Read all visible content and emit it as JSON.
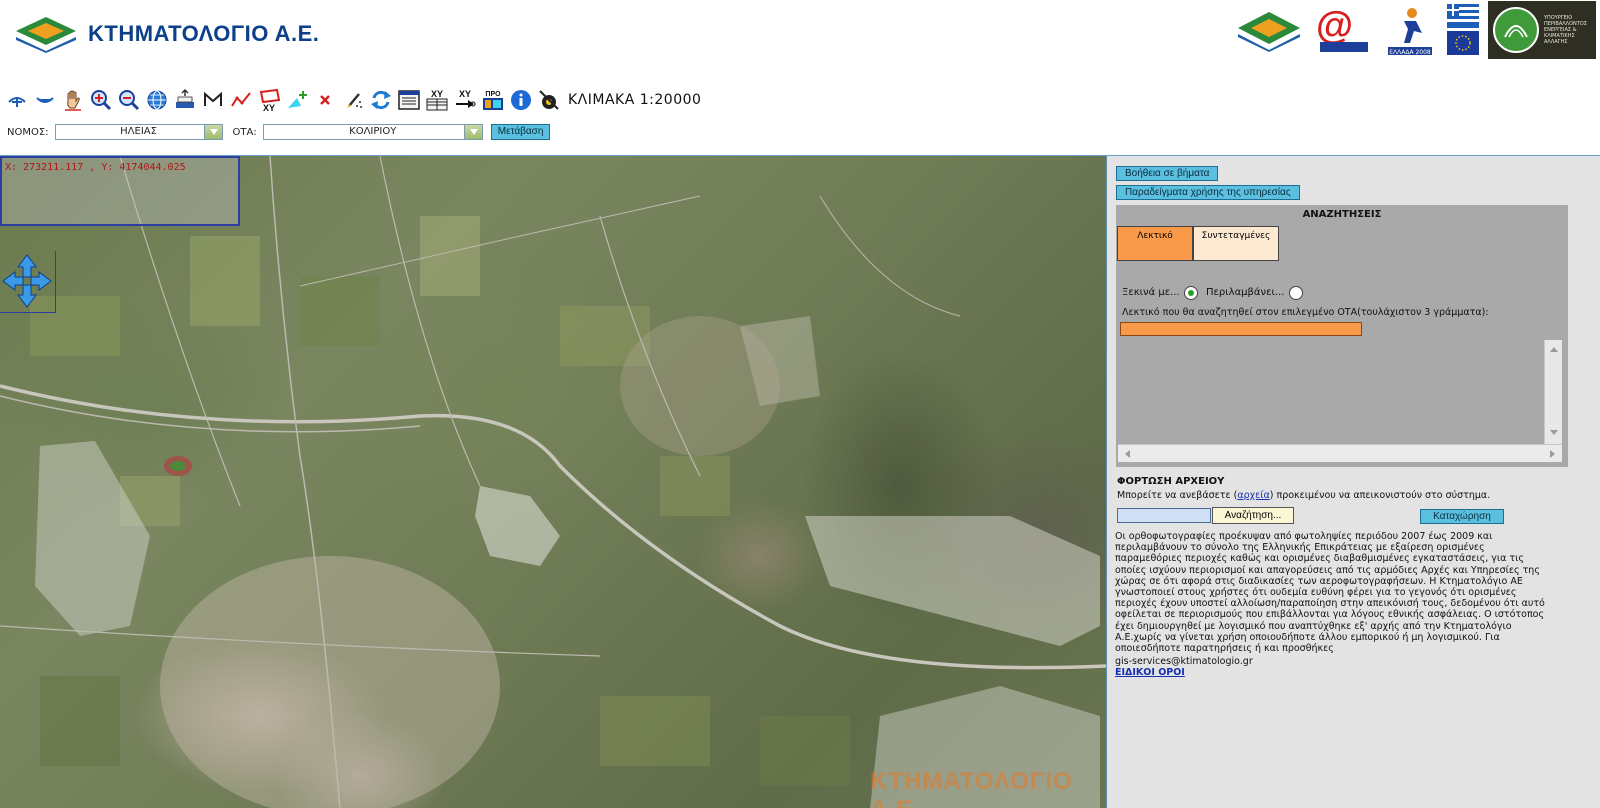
{
  "header": {
    "logo_text": "ΚΤΗΜΑΤΟΛΟΓΙΟ Α.Ε.",
    "partner_logos": [
      "ktimatologio-logo",
      "information-society-logo",
      "ellada-2008-logo",
      "greece-eu-flags",
      "ministry-environment-logo"
    ],
    "ministry_text": "ΥΠΟΥΡΓΕΙΟ ΠΕΡΙΒΑΛΛΟΝΤΟΣ ΕΝΕΡΓΕΙΑΣ & ΚΛΙΜΑΤΙΚΗΣ ΑΛΛΑΓΗΣ",
    "ellada_text": "ΕΛΛΑΔΑ 2008"
  },
  "toolbar": {
    "scale_label": "ΚΛΙΜΑΚΑ 1:20000",
    "xy_label": "XY",
    "pro_label": "ΠΡΟ"
  },
  "location": {
    "prefecture_label": "ΝΟΜΟΣ:",
    "prefecture_value": "ΗΛΕΙΑΣ",
    "municipality_label": "ΟΤΑ:",
    "municipality_value": "ΚΟΛΙΡΙΟΥ",
    "go_button": "Μετάβαση"
  },
  "map": {
    "coordinates": "X: 273211.117 , Y: 4174044.025",
    "watermark": "ΚΤΗΜΑΤΟΛΟΓΙΟ Α.Ε."
  },
  "panel": {
    "help_button": "Βοήθεια σε βήματα",
    "examples_button": "Παραδείγματα χρήσης της υπηρεσίας",
    "search": {
      "title": "ΑΝΑΖΗΤΗΣΕΙΣ",
      "tab_text": "Λεκτικό",
      "tab_coords": "Συντεταγμένες",
      "radio_starts": "Ξεκινά με...",
      "radio_contains": "Περιλαμβάνει...",
      "hint": "Λεκτικό που θα αναζητηθεί στον επιλεγμένο ΟΤΑ(τουλάχιστον 3 γράμματα):",
      "input_value": ""
    },
    "upload": {
      "title": "ΦΟΡΤΩΣΗ ΑΡΧΕΙΟΥ",
      "desc_before": "Μπορείτε να ανεβάσετε (",
      "desc_link": "αρχεία",
      "desc_after": ") προκειμένου να απεικονιστούν στο σύστημα.",
      "browse_button": "Αναζήτηση...",
      "submit_button": "Καταχώρηση"
    },
    "disclaimer": "Οι ορθοφωτογραφίες προέκυψαν από φωτοληψίες περιόδου 2007 έως 2009 και περιλαμβάνουν το σύνολο της Ελληνικής Επικράτειας με εξαίρεση ορισμένες παραμεθόριες περιοχές καθώς και ορισμένες διαβαθμισμένες εγκαταστάσεις, για τις οποίες ισχύουν περιορισμοί και απαγορεύσεις από τις αρμόδιες Αρχές και Υπηρεσίες της χώρας σε ότι αφορά στις διαδικασίες των αεροφωτογραφήσεων. Η Κτηματολόγιο ΑΕ γνωστοποιεί στους χρήστες ότι ουδεμία ευθύνη φέρει για το γεγονός ότι ορισμένες περιοχές έχουν υποστεί αλλοίωση/παραποίηση στην απεικόνισή τους, δεδομένου ότι αυτό οφείλεται σε περιορισμούς που επιβάλλονται για λόγους εθνικής ασφάλειας. Ο ιστότοπος έχει δημιουργηθεί με λογισμικό που αναπτύχθηκε εξ' αρχής από την Κτηματολόγιο Α.Ε.χωρίς να γίνεται χρήση οποιουδήποτε άλλου εμπορικού ή μη λογισμικού. Για οποιεσδήποτε παρατηρήσεις ή και προσθήκες",
    "email": "gis-services@ktimatologio.gr",
    "terms_link": "ΕΙΔΙΚΟΙ ΟΡΟΙ"
  }
}
